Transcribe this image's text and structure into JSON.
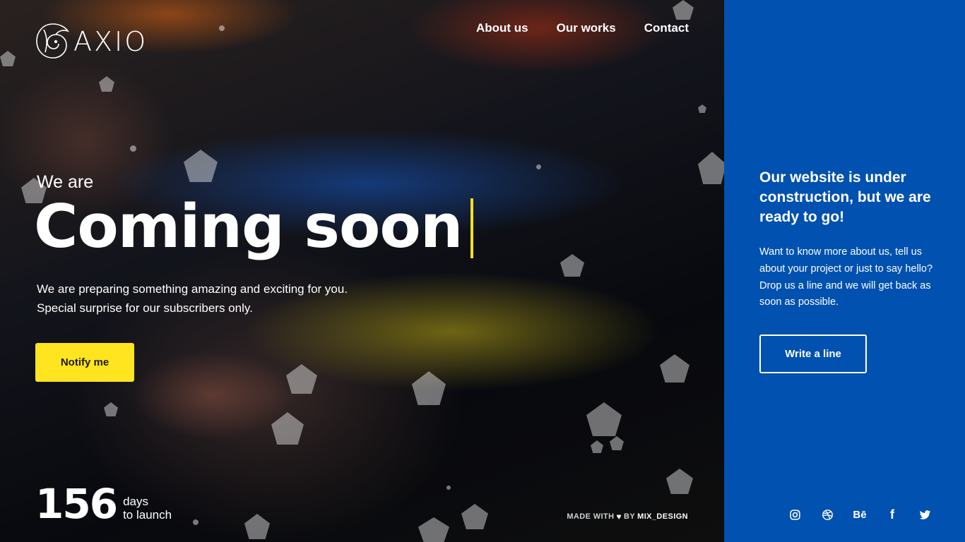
{
  "brand": {
    "name": "AXIO",
    "logo_icon": "spiral-logo-icon"
  },
  "nav": {
    "items": [
      "About us",
      "Our works",
      "Contact"
    ]
  },
  "hero": {
    "pre_title": "We are",
    "title": "Coming soon",
    "subtitle_line1": "We are preparing something amazing and exciting for you.",
    "subtitle_line2": "Special surprise for our subscribers only.",
    "cta_label": "Notify me"
  },
  "countdown": {
    "value": "156",
    "label_line1": "days",
    "label_line2": "to launch"
  },
  "footer": {
    "made_with": "MADE WITH",
    "heart_icon": "heart-icon",
    "by": "BY",
    "author": "MIX_DESIGN"
  },
  "sidebar": {
    "title": "Our website is under construction, but we are ready to go!",
    "text": "Want to know more about us, tell us about your project or just to say hello? Drop us a line and we will get back as soon as possible.",
    "button_label": "Write a line",
    "social": [
      {
        "icon": "instagram-icon"
      },
      {
        "icon": "dribbble-icon"
      },
      {
        "icon": "behance-icon",
        "glyph": "Bē"
      },
      {
        "icon": "facebook-icon",
        "glyph": "f"
      },
      {
        "icon": "twitter-icon"
      }
    ]
  },
  "colors": {
    "accent_yellow": "#fee51f",
    "sidebar_blue": "#0051b0",
    "text_white": "#ffffff"
  }
}
